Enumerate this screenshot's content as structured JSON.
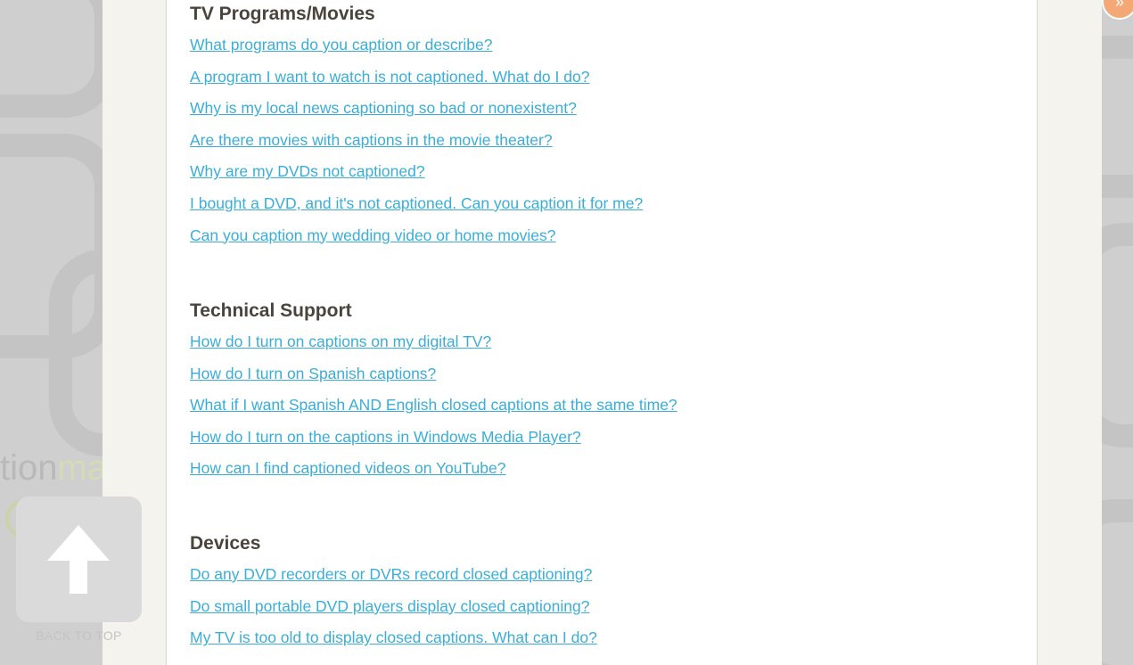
{
  "background": {
    "logo_text_main": "tion",
    "logo_text_tail": "ma"
  },
  "sections": [
    {
      "title": "TV Programs/Movies",
      "links": [
        "What programs do you caption or describe?",
        "A program I want to watch is not captioned. What do I do?",
        "Why is my local news captioning so bad or nonexistent?",
        "Are there movies with captions in the movie theater?",
        "Why are my DVDs not captioned?",
        "I bought a DVD, and it's not captioned. Can you caption it for me?",
        "Can you caption my wedding video or home movies?"
      ]
    },
    {
      "title": "Technical Support",
      "links": [
        "How do I turn on captions on my digital TV?",
        "How do I turn on Spanish captions?",
        "What if I want Spanish AND English closed captions at the same time?",
        "How do I turn on the captions in Windows Media Player?",
        "How can I find captioned videos on YouTube?"
      ]
    },
    {
      "title": "Devices",
      "links": [
        "Do any DVD recorders or DVRs record closed captioning?",
        "Do small portable DVD players display closed captioning?",
        "My TV is too old to display closed captions. What can I do?"
      ]
    }
  ],
  "back_to_top": {
    "label": "BACK TO TOP",
    "icon": "arrow-up-icon"
  },
  "corner_badge": {
    "icon": "double-chevron-right-icon"
  },
  "colors": {
    "link": "#3aaed8",
    "heading": "#4a443d",
    "badge": "#f3a875"
  }
}
